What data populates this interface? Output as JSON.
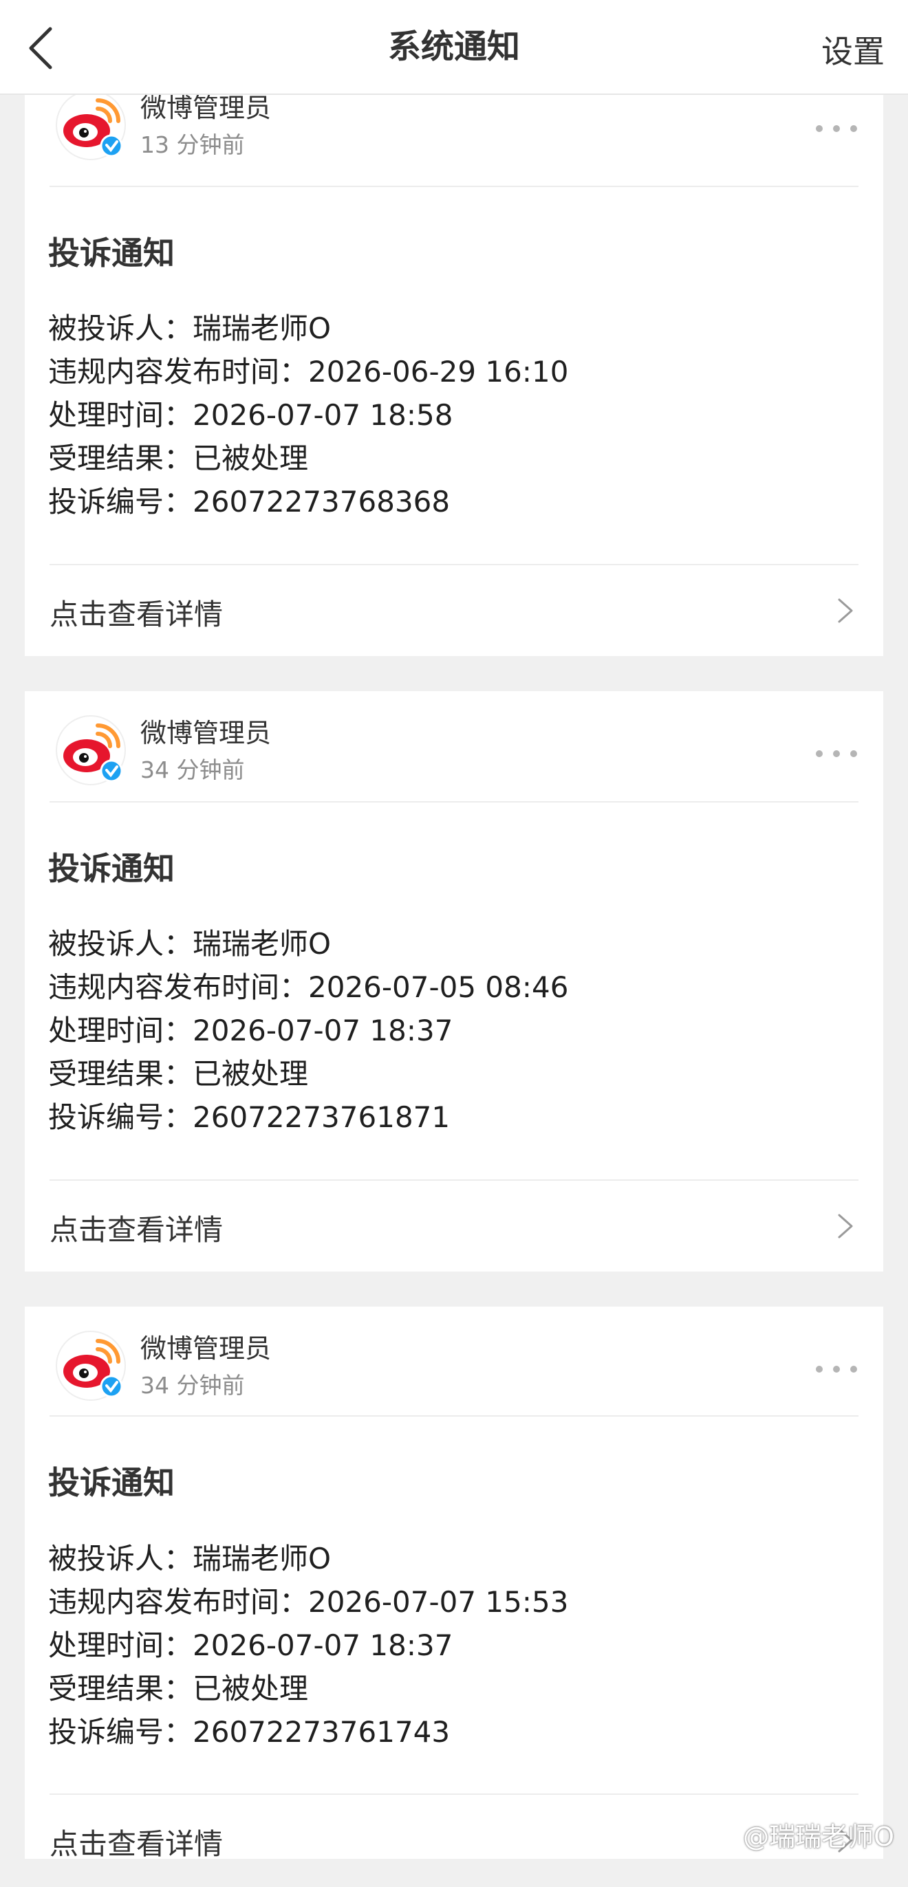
{
  "header": {
    "title": "系统通知",
    "settings_label": "设置"
  },
  "notifications": [
    {
      "sender": "微博管理员",
      "time": "13 分钟前",
      "title": "投诉通知",
      "fields": [
        "被投诉人：瑞瑞老师O",
        "违规内容发布时间：2026-06-29 16:10",
        "处理时间：2026-07-07 18:58",
        "受理结果：已被处理",
        "投诉编号：26072273768368"
      ],
      "detail_label": "点击查看详情"
    },
    {
      "sender": "微博管理员",
      "time": "34 分钟前",
      "title": "投诉通知",
      "fields": [
        "被投诉人：瑞瑞老师O",
        "违规内容发布时间：2026-07-05 08:46",
        "处理时间：2026-07-07 18:37",
        "受理结果：已被处理",
        "投诉编号：26072273761871"
      ],
      "detail_label": "点击查看详情"
    },
    {
      "sender": "微博管理员",
      "time": "34 分钟前",
      "title": "投诉通知",
      "fields": [
        "被投诉人：瑞瑞老师O",
        "违规内容发布时间：2026-07-07 15:53",
        "处理时间：2026-07-07 18:37",
        "受理结果：已被处理",
        "投诉编号：26072273761743"
      ],
      "detail_label": "点击查看详情"
    }
  ],
  "watermark": "@瑞瑞老师O",
  "colors": {
    "weibo_red": "#e6162d",
    "weibo_orange": "#ff9933",
    "verified_blue": "#1da1f2",
    "page_bg": "#f0f0f0"
  }
}
